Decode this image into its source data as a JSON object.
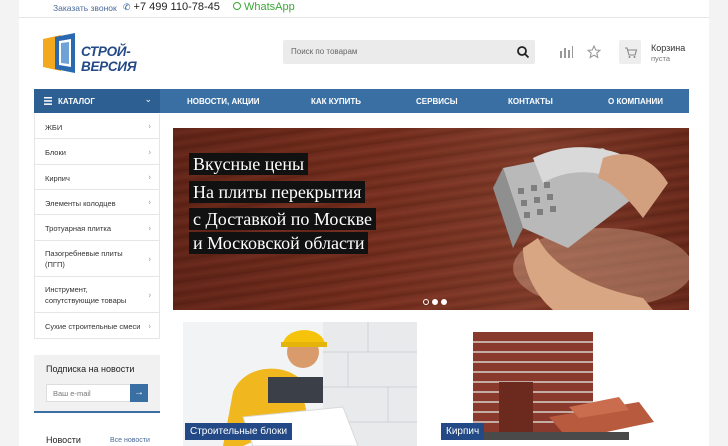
{
  "topbar": {
    "callback": "Заказать звонок",
    "phone": "+7 499 110-78-45",
    "whatsapp": "WhatsApp"
  },
  "header": {
    "logo_text": "СТРОЙ-ВЕРСИЯ",
    "search_placeholder": "Поиск по товарам",
    "cart_label": "Корзина",
    "cart_status": "пуста",
    "icons": [
      "chart-icon",
      "star-icon",
      "cart-icon",
      "search-icon"
    ]
  },
  "nav": {
    "catalog": "КАТАЛОГ",
    "items": [
      "НОВОСТИ, АКЦИИ",
      "КАК КУПИТЬ",
      "СЕРВИСЫ",
      "КОНТАКТЫ",
      "О КОМПАНИИ"
    ]
  },
  "sidebar": {
    "items": [
      "ЖБИ",
      "Блоки",
      "Кирпич",
      "Элементы колодцев",
      "Тротуарная плитка",
      "Пазогребневые плиты (ПГП)",
      "Инструмент, сопутствующие товары",
      "Сухие строительные смеси"
    ]
  },
  "subscribe": {
    "title": "Подписка на новости",
    "placeholder": "Ваш e-mail",
    "button": "→"
  },
  "news": {
    "title": "Новости",
    "all_link": "Все новости"
  },
  "banner": {
    "lines": [
      "Вкусные цены",
      "На плиты перекрытия",
      "с Доставкой по Москве",
      "и Московской области"
    ],
    "slides": 3,
    "active_slide": 1
  },
  "products": [
    {
      "label": "Строительные блоки"
    },
    {
      "label": "Кирпич"
    }
  ],
  "colors": {
    "nav_blue": "#3a6fa4",
    "catalog_blue": "#2e5f93",
    "label_blue": "#234a86",
    "whatsapp_green": "#3aa835"
  }
}
